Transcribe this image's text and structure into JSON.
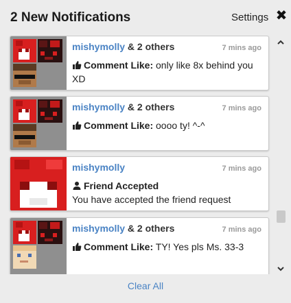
{
  "header": {
    "title": "2 New Notifications",
    "settings_label": "Settings",
    "close_icon": "close-icon"
  },
  "notifications": [
    {
      "user": "mishymolly",
      "others": "& 2 others",
      "time": "7 mins ago",
      "kind": "Comment Like:",
      "message": "only like 8x behind you XD",
      "icon": "thumbs-up-icon"
    },
    {
      "user": "mishymolly",
      "others": "& 2 others",
      "time": "7 mins ago",
      "kind": "Comment Like:",
      "message": "oooo ty! ^-^",
      "icon": "thumbs-up-icon"
    },
    {
      "user": "mishymolly",
      "others": "",
      "time": "7 mins ago",
      "kind": "Friend Accepted",
      "message": "You have accepted the friend request",
      "icon": "user-icon"
    },
    {
      "user": "mishymolly",
      "others": "& 2 others",
      "time": "7 mins ago",
      "kind": "Comment Like:",
      "message": "TY! Yes pls Ms. 33-3",
      "icon": "thumbs-up-icon"
    }
  ],
  "footer": {
    "clear_all_label": "Clear All"
  },
  "colors": {
    "link": "#4a83c4",
    "background": "#ececec",
    "avatar_red": "#d81f1f"
  }
}
